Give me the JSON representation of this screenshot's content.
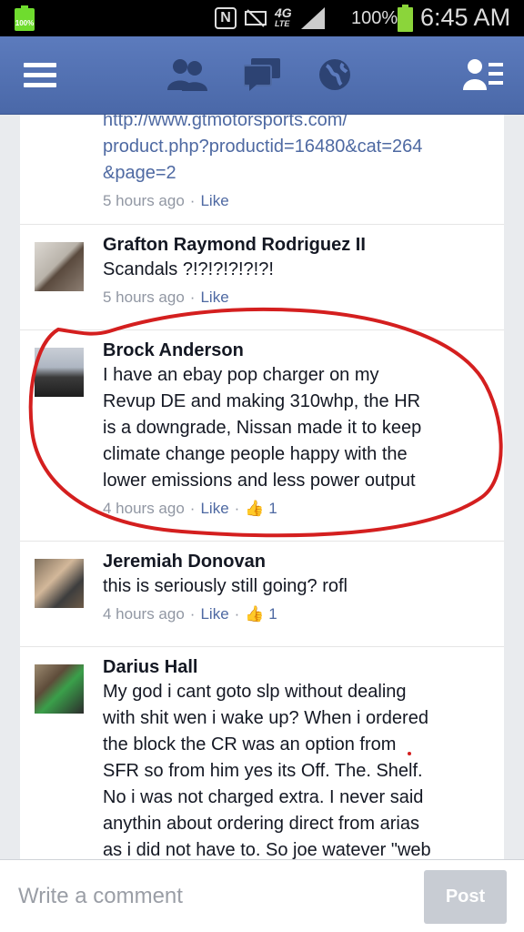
{
  "status_bar": {
    "battery_left_text": "100%",
    "network": "4G",
    "network_sub": "LTE",
    "battery_percent": "100%",
    "time": "6:45 AM"
  },
  "header": {
    "icons": [
      "menu-icon",
      "friend-requests-icon",
      "messages-icon",
      "notifications-globe-icon",
      "contacts-icon"
    ]
  },
  "comments": [
    {
      "link_lines": [
        "http://www.gtmotorsports.com/",
        "product.php?productid=16480&cat=264",
        "&page=2"
      ],
      "time": "5 hours ago",
      "like": "Like"
    },
    {
      "author": "Grafton Raymond Rodriguez II",
      "text": "Scandals ?!?!?!?!?!?!",
      "time": "5 hours ago",
      "like": "Like"
    },
    {
      "author": "Brock Anderson",
      "text_lines": [
        "I have an ebay pop charger on my",
        "Revup DE and making 310whp, the HR",
        "is a downgrade, Nissan made it to keep",
        "climate change people happy with the",
        "lower emissions and less power output"
      ],
      "time": "4 hours ago",
      "like": "Like",
      "like_count": "1"
    },
    {
      "author": "Jeremiah Donovan",
      "text": "this is seriously still going? rofl",
      "time": "4 hours ago",
      "like": "Like",
      "like_count": "1"
    },
    {
      "author": "Darius Hall",
      "text_lines": [
        "My god i cant goto slp without dealing",
        "with shit wen i wake up? When i ordered",
        "the block the CR was an option from",
        "SFR so from him yes its Off. The. Shelf.",
        "No i was not charged extra. I never said",
        "anythin about ordering direct from arias",
        "as i did not have to. So joe watever \"web"
      ]
    }
  ],
  "compose": {
    "placeholder": "Write a comment",
    "post_label": "Post"
  },
  "colors": {
    "header_blue": "#4e69a2",
    "annotation_red": "#d41f1f",
    "battery_green": "#8bd53a"
  }
}
